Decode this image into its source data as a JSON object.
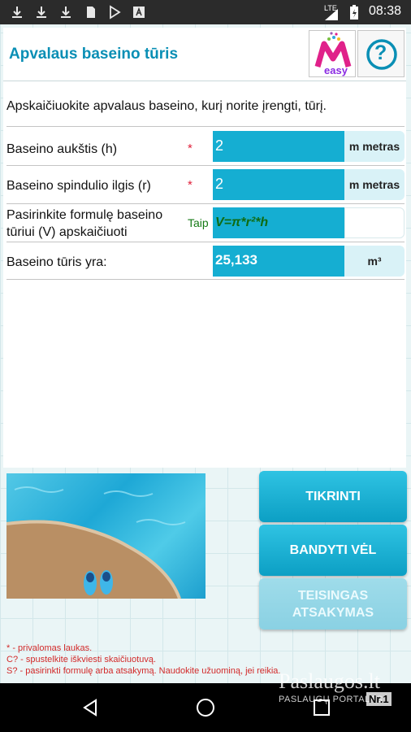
{
  "status_bar": {
    "time": "08:38",
    "network": "LTE",
    "left_icons": [
      "download-icon",
      "download-icon",
      "download-icon",
      "sd-card-icon",
      "play-store-icon",
      "font-icon"
    ]
  },
  "header": {
    "title": "Apvalaus baseino tūris",
    "logo_text": "easy",
    "help_symbol": "?"
  },
  "intro": "Apskaičiuokite apvalaus baseino, kurį norite įrengti, tūrį.",
  "rows": [
    {
      "label": "Baseino aukštis (h)",
      "marker": "*",
      "value": "2",
      "unit": "m metras"
    },
    {
      "label": "Baseino spindulio ilgis (r)",
      "marker": "*",
      "value": "2",
      "unit": "m metras"
    },
    {
      "label_line1": "Pasirinkite formulę baseino",
      "label_line2": "tūriui (V) apskaičiuoti",
      "marker": "Taip",
      "value": "V=π*r²*h",
      "unit": ""
    },
    {
      "label": "Baseino tūris yra:",
      "marker": "",
      "value": "25,133",
      "unit": "m³"
    }
  ],
  "buttons": {
    "check": "TIKRINTI",
    "retry": "BANDYTI VĖL",
    "answer_line1": "TEISINGAS",
    "answer_line2": "ATSAKYMAS"
  },
  "footnotes": [
    "* - privalomas laukas.",
    "C? - spustelkite iškviesti skaičiuotuvą.",
    "S? - pasirinkti formulę arba atsakymą. Naudokite užuominą, jei reikia."
  ],
  "watermark": {
    "brand": "Paslaugos.lt",
    "tagline": "PASLAUGŲ PORTALAS",
    "badge": "Nr.1"
  },
  "colors": {
    "accent": "#15aed2",
    "title": "#0a8fb5",
    "required": "#e0203a",
    "formula": "#0f6b12"
  }
}
